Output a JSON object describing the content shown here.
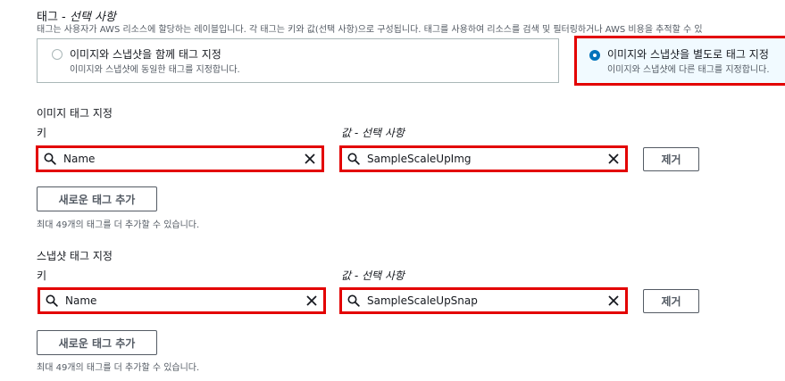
{
  "tags": {
    "title": "태그 - ",
    "title_optional": "선택 사항",
    "description": "태그는 사용자가 AWS 리소스에 할당하는 레이블입니다. 각 태그는 키와 값(선택 사항)으로 구성됩니다. 태그를 사용하여 리소스를 검색 및 필터링하거나 AWS 비용을 추적할 수 있",
    "options": [
      {
        "title": "이미지와 스냅샷을 함께 태그 지정",
        "description": "이미지와 스냅샷에 동일한 태그를 지정합니다.",
        "selected": false
      },
      {
        "title": "이미지와 스냅샷을 별도로 태그 지정",
        "description": "이미지와 스냅샷에 다른 태그를 지정합니다.",
        "selected": true
      }
    ]
  },
  "image_tags": {
    "section_title": "이미지 태그 지정",
    "key_label": "키",
    "value_label": "값 - 선택 사항",
    "key_value": "Name",
    "value_value": "SampleScaleUpImg",
    "remove_label": "제거",
    "add_label": "새로운 태그 추가",
    "note": "최대 49개의 태그를 더 추가할 수 있습니다."
  },
  "snapshot_tags": {
    "section_title": "스냅샷 태그 지정",
    "key_label": "키",
    "value_label": "값 - 선택 사항",
    "key_value": "Name",
    "value_value": "SampleScaleUpSnap",
    "remove_label": "제거",
    "add_label": "새로운 태그 추가",
    "note": "최대 49개의 태그를 더 추가할 수 있습니다."
  },
  "colors": {
    "highlight": "#e30000",
    "radio_selected": "#0073bb",
    "selected_card_bg": "#f1faff"
  },
  "icons": {
    "search": "search-icon",
    "clear": "close-icon"
  }
}
